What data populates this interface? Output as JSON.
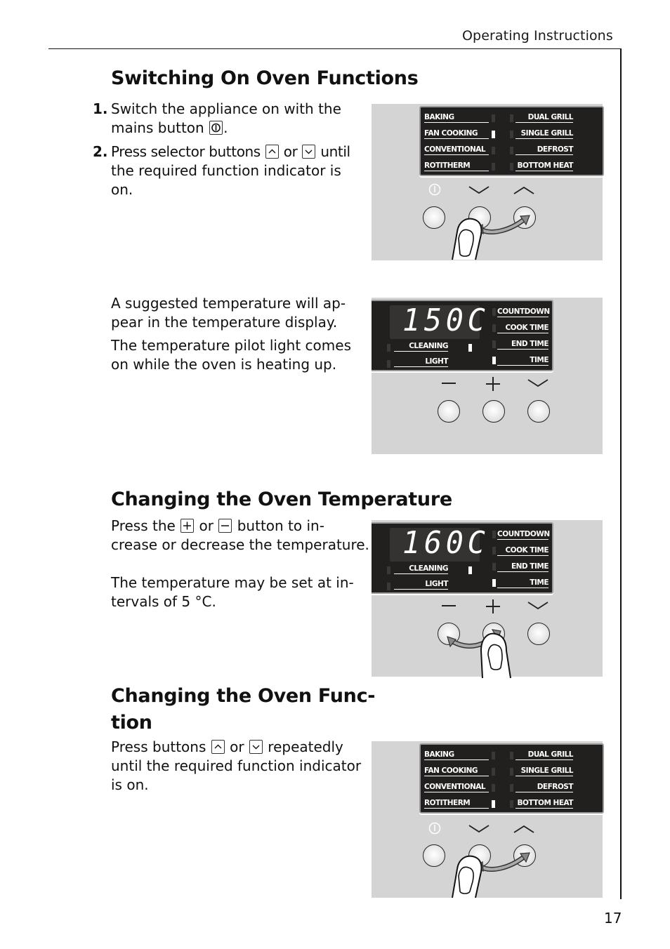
{
  "header": {
    "section": "Operating Instructions"
  },
  "page_number": "17",
  "sections": {
    "switching_on": {
      "title": "Switching On Oven Functions",
      "steps": [
        {
          "number": "1.",
          "text_before": "Switch the appliance on with the",
          "text_line2": "mains button",
          "icon": "power-key-icon",
          "text_after": "."
        },
        {
          "number": "2.",
          "text_before": "Press selector buttons",
          "icon1": "up-arrow-key-icon",
          "middle": "or",
          "icon2": "down-arrow-key-icon",
          "text_after": "until",
          "text_line2": "the required function indicator is",
          "text_line3": "on."
        }
      ],
      "note_lines": [
        "A suggested temperature will ap-",
        "pear in the temperature display."
      ],
      "note2_lines": [
        "The temperature pilot light comes",
        "on while the oven is heating up."
      ]
    },
    "changing_temperature": {
      "title": "Changing the Oven Temperature",
      "line1_before": "Press the",
      "line1_icon1": "plus-key-icon",
      "line1_middle": "or",
      "line1_icon2": "minus-key-icon",
      "line1_after": "button to in-",
      "line2": "crease or decrease the temperature.",
      "note_lines": [
        "The temperature may be set at in-",
        "tervals of 5 °C."
      ]
    },
    "changing_function": {
      "title_lines": [
        "Changing the Oven Func-",
        "tion"
      ],
      "line1_before": "Press buttons",
      "line1_icon1": "up-arrow-key-icon",
      "line1_middle": "or",
      "line1_icon2": "down-arrow-key-icon",
      "line1_after": "repeatedly",
      "line2": "until the required function indicator",
      "line3": "is on."
    }
  },
  "panels": {
    "function_panel_1": {
      "left_labels": [
        "BAKING",
        "FAN COOKING",
        "CONVENTIONAL",
        "ROTITHERM"
      ],
      "right_labels": [
        "DUAL GRILL",
        "SINGLE GRILL",
        "DEFROST",
        "BOTTOM HEAT"
      ],
      "active_left_index": 1,
      "buttons": [
        "power",
        "down",
        "up"
      ],
      "gesture": "finger pressing down button, arrow to up button"
    },
    "temperature_panel_1": {
      "display": "150C",
      "left_labels": [
        "CLEANING",
        "LIGHT"
      ],
      "right_labels": [
        "COUNTDOWN",
        "COOK TIME",
        "END TIME",
        "TIME"
      ],
      "pilot_light_on": true,
      "time_indicator_on": true,
      "buttons": [
        "minus",
        "plus",
        "down"
      ]
    },
    "temperature_panel_2": {
      "display": "160C",
      "left_labels": [
        "CLEANING",
        "LIGHT"
      ],
      "right_labels": [
        "COUNTDOWN",
        "COOK TIME",
        "END TIME",
        "TIME"
      ],
      "pilot_light_on": true,
      "time_indicator_on": true,
      "buttons": [
        "minus",
        "plus",
        "down"
      ],
      "gesture": "finger pressing plus button, arrow to minus button"
    },
    "function_panel_2": {
      "left_labels": [
        "BAKING",
        "FAN COOKING",
        "CONVENTIONAL",
        "ROTITHERM"
      ],
      "right_labels": [
        "DUAL GRILL",
        "SINGLE GRILL",
        "DEFROST",
        "BOTTOM HEAT"
      ],
      "active_left_index": 3,
      "buttons": [
        "power",
        "down",
        "up"
      ],
      "gesture": "finger pressing down button, arrow to up button"
    }
  },
  "colors": {
    "panel_bg": "#d4d4d4",
    "screen_bg": "#221f1f",
    "text": "#111111"
  }
}
